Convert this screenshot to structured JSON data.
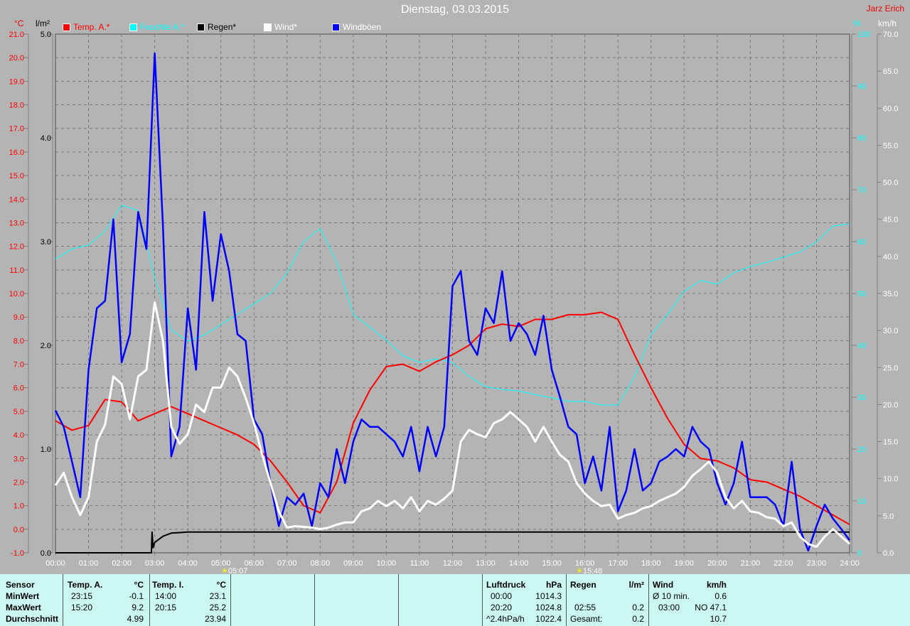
{
  "header": {
    "title": "Dienstag, 03.03.2015",
    "author": "Jarz Erich"
  },
  "legend": [
    {
      "label": "Temp. A.*",
      "color": "#ff0000"
    },
    {
      "label": "Feuchte A.*",
      "color": "#00ffff"
    },
    {
      "label": "Regen*",
      "color": "#000000"
    },
    {
      "label": "Wind*",
      "color": "#ffffff"
    },
    {
      "label": "Windböen",
      "color": "#0000ff"
    }
  ],
  "units": {
    "temp": "°C",
    "rain": "l/m²",
    "humidity": "%",
    "wind": "km/h"
  },
  "markers": {
    "sunrise": "05:07",
    "sunset": "15:48"
  },
  "chart_data": {
    "type": "line",
    "title": "Dienstag, 03.03.2015",
    "x_unit": "hour of day",
    "x_range": [
      0,
      24
    ],
    "x_ticks": [
      "00:00",
      "01:00",
      "02:00",
      "03:00",
      "04:00",
      "05:00",
      "06:00",
      "07:00",
      "08:00",
      "09:00",
      "10:00",
      "11:00",
      "12:00",
      "13:00",
      "14:00",
      "15:00",
      "16:00",
      "17:00",
      "18:00",
      "19:00",
      "20:00",
      "21:00",
      "22:00",
      "23:00",
      "24:00"
    ],
    "axes": {
      "temp": {
        "range": [
          -1,
          21
        ],
        "ticks": [
          "21.0",
          "20.0",
          "19.0",
          "18.0",
          "17.0",
          "16.0",
          "15.0",
          "14.0",
          "13.0",
          "12.0",
          "11.0",
          "10.0",
          "9.0",
          "8.0",
          "7.0",
          "6.0",
          "5.0",
          "4.0",
          "3.0",
          "2.0",
          "1.0",
          "0.0",
          "-1.0"
        ]
      },
      "rain": {
        "range": [
          0,
          5
        ],
        "ticks": [
          "5.0",
          "4.0",
          "3.0",
          "2.0",
          "1.0",
          "0.0"
        ]
      },
      "humidity": {
        "range": [
          0,
          100
        ],
        "ticks": [
          "100",
          "90",
          "80",
          "70",
          "60",
          "50",
          "40",
          "30",
          "20",
          "10",
          "0"
        ]
      },
      "wind": {
        "range": [
          0,
          70
        ],
        "ticks": [
          "70.0",
          "65.0",
          "60.0",
          "55.0",
          "50.0",
          "45.0",
          "40.0",
          "35.0",
          "30.0",
          "25.0",
          "20.0",
          "15.0",
          "10.0",
          "5.0",
          "0.0"
        ]
      }
    },
    "grid": true,
    "series": [
      {
        "name": "Temp. A.*",
        "axis": "temp",
        "color": "#ff0000",
        "interval_minutes": 30,
        "values": [
          4.6,
          4.2,
          4.4,
          5.5,
          5.4,
          4.6,
          4.9,
          5.2,
          4.9,
          4.6,
          4.3,
          4.0,
          3.6,
          2.9,
          2.0,
          1.0,
          0.7,
          2.0,
          4.5,
          5.9,
          6.9,
          7.0,
          6.7,
          7.1,
          7.4,
          7.8,
          8.5,
          8.7,
          8.6,
          8.9,
          8.9,
          9.1,
          9.1,
          9.2,
          8.9,
          7.4,
          6.0,
          4.7,
          3.6,
          3.0,
          2.9,
          2.6,
          2.1,
          2.0,
          1.7,
          1.4,
          1.0,
          0.6,
          0.2
        ]
      },
      {
        "name": "Feuchte A.*",
        "axis": "humidity",
        "color": "#00ffff",
        "interval_minutes": 30,
        "values": [
          56.6,
          58.6,
          59.3,
          62,
          67,
          66,
          53,
          43,
          40.8,
          42,
          44,
          46,
          48,
          50,
          54,
          60,
          62.5,
          56,
          46,
          43.5,
          41,
          38,
          36.7,
          37.4,
          36.7,
          34,
          32,
          31.5,
          31.2,
          30.5,
          29.9,
          29.2,
          29.2,
          28.5,
          28.5,
          34,
          42,
          46,
          50.4,
          52.5,
          51.8,
          54,
          55.2,
          56,
          57,
          58,
          60,
          63,
          63.4
        ]
      },
      {
        "name": "Regen*",
        "axis": "rain",
        "color": "#000000",
        "points": [
          [
            0,
            0
          ],
          [
            2.9,
            0
          ],
          [
            2.92,
            0.2
          ],
          [
            2.95,
            0.05
          ],
          [
            3.0,
            0.1
          ],
          [
            3.25,
            0.16
          ],
          [
            3.5,
            0.19
          ],
          [
            4.0,
            0.2
          ],
          [
            24,
            0.2
          ]
        ]
      },
      {
        "name": "Wind*",
        "axis": "wind",
        "color": "#ffffff",
        "interval_minutes": 15,
        "values": [
          9.1,
          10.8,
          7.5,
          5.1,
          7.5,
          15,
          17.3,
          23.8,
          22.8,
          18,
          23.8,
          24.7,
          33.8,
          28.6,
          17,
          14.7,
          16,
          20,
          19,
          22.3,
          22.3,
          25,
          23.8,
          20.9,
          17.5,
          13.2,
          9.4,
          5.6,
          3.4,
          3.6,
          3.5,
          3.4,
          3.2,
          3.4,
          3.8,
          4.1,
          4.1,
          5.6,
          6,
          7,
          6.3,
          7,
          6,
          7.5,
          5.6,
          7,
          6.5,
          7.3,
          8.4,
          15,
          16.6,
          16,
          15.6,
          17.5,
          18,
          19,
          18,
          17,
          15,
          17,
          15,
          13.2,
          12.3,
          9.4,
          8,
          7,
          6.3,
          6.5,
          4.6,
          5.1,
          5.4,
          6,
          6.3,
          7,
          7.5,
          8,
          8.9,
          10.4,
          11.3,
          12.3,
          10.8,
          7.5,
          6,
          7,
          5.6,
          5.4,
          4.8,
          4.6,
          3.6,
          4.1,
          2.2,
          1.2,
          0.8,
          2.2,
          3.2,
          2.2,
          1.2
        ]
      },
      {
        "name": "Windböen",
        "axis": "wind",
        "color": "#0000ff",
        "interval_minutes": 15,
        "values": [
          19.2,
          17,
          12.3,
          7.5,
          24.7,
          33,
          34,
          45,
          25.7,
          29.5,
          46,
          41,
          67.4,
          44,
          13,
          17,
          33,
          24.7,
          46,
          34,
          43,
          38,
          29.5,
          28.6,
          18,
          16,
          9.4,
          3.6,
          7.5,
          6.5,
          8,
          3.6,
          9.4,
          7.5,
          14,
          9.4,
          15,
          18,
          17,
          17,
          16,
          15,
          13,
          17,
          11,
          17,
          13,
          17,
          36,
          38,
          28.6,
          26.7,
          33,
          31,
          38,
          28.6,
          31,
          29.5,
          26.7,
          32,
          24.7,
          21,
          17,
          16,
          9.4,
          13,
          8.4,
          17,
          5.6,
          8.4,
          14,
          8.4,
          9.4,
          12.3,
          13,
          14,
          13,
          17,
          15,
          14,
          9.4,
          6.5,
          9.4,
          15,
          7.5,
          7.5,
          7.5,
          6.5,
          3.6,
          12.3,
          3.2,
          0.3,
          3.6,
          6.5,
          4.6,
          3.2,
          1.7
        ]
      }
    ]
  },
  "stats": {
    "row_labels": [
      "Sensor",
      "MinWert",
      "MaxWert",
      "Durchschnitt"
    ],
    "temp_a": {
      "header": "Temp. A.",
      "unit": "°C",
      "min_time": "23:15",
      "min": "-0.1",
      "max_time": "15:20",
      "max": "9.2",
      "avg": "4.99"
    },
    "temp_i": {
      "header": "Temp. I.",
      "unit": "°C",
      "min_time": "14:00",
      "min": "23.1",
      "max_time": "20:15",
      "max": "25.2",
      "avg": "23.94"
    },
    "pressure": {
      "header": "Luftdruck",
      "unit": "hPa",
      "r1_label": "00:00",
      "r1": "1014.3",
      "r2_label": "20:20",
      "r2": "1024.8",
      "r3_label": "^2.4hPa/h",
      "r3": "1022.4"
    },
    "rain": {
      "header": "Regen",
      "unit": "l/m²",
      "r2_label": "02:55",
      "r2": "0.2",
      "r3_label": "Gesamt:",
      "r3": "0.2"
    },
    "wind": {
      "header": "Wind",
      "unit": "km/h",
      "r1_label": "Ø 10 min.",
      "r1": "0.6",
      "r2_label": "03:00",
      "r2": "NO 47.1",
      "r3": "10.7"
    }
  }
}
